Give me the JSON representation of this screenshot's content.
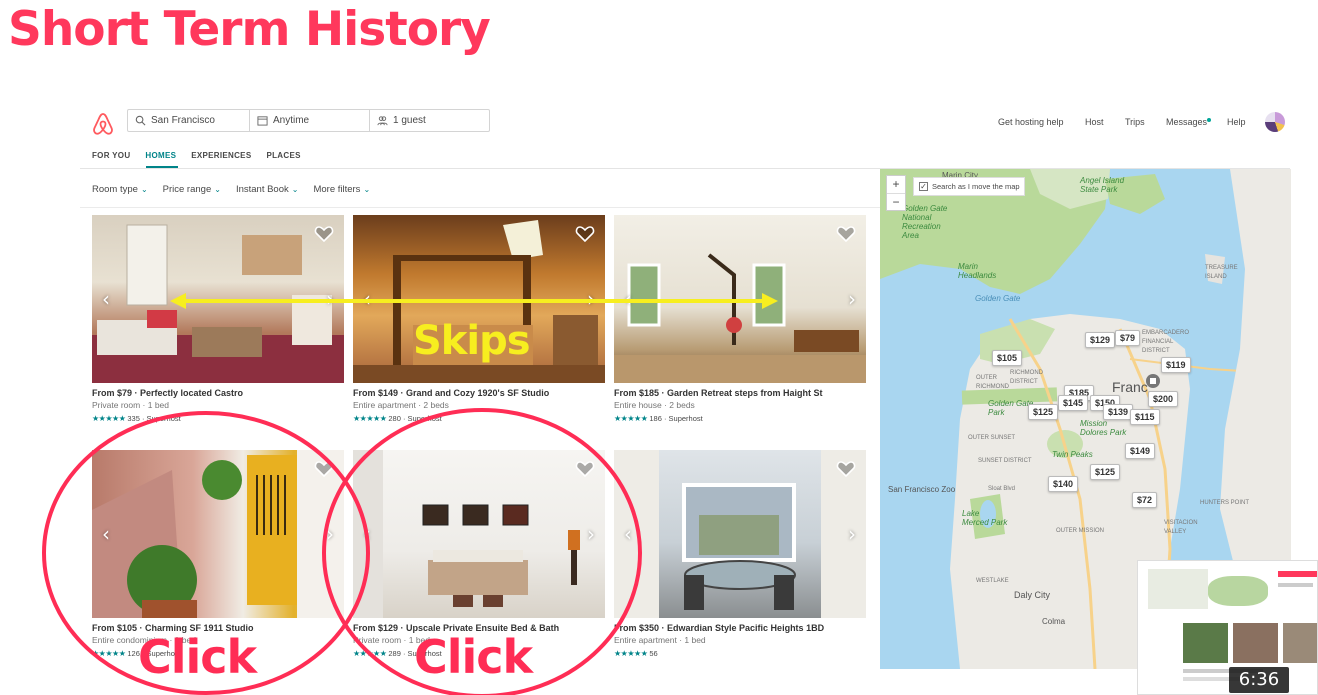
{
  "slide": {
    "title": "Short Term History"
  },
  "search": {
    "location": "San Francisco",
    "dates": "Anytime",
    "guests": "1 guest"
  },
  "topnav": {
    "hosting_help": "Get hosting help",
    "host": "Host",
    "trips": "Trips",
    "messages": "Messages",
    "help": "Help"
  },
  "tabs": [
    {
      "label": "FOR YOU"
    },
    {
      "label": "HOMES",
      "active": true
    },
    {
      "label": "EXPERIENCES"
    },
    {
      "label": "PLACES"
    }
  ],
  "filters": [
    {
      "label": "Room type"
    },
    {
      "label": "Price range"
    },
    {
      "label": "Instant Book"
    },
    {
      "label": "More filters"
    }
  ],
  "listings": [
    {
      "title": "From $79 · Perfectly located Castro",
      "sub": "Private room · 1 bed",
      "reviews": "335 · Superhost"
    },
    {
      "title": "From $149 · Grand and Cozy 1920's SF Studio",
      "sub": "Entire apartment · 2 beds",
      "reviews": "280 · Superhost"
    },
    {
      "title": "From $185 · Garden Retreat steps from Haight St",
      "sub": "Entire house · 2 beds",
      "reviews": "186 · Superhost"
    },
    {
      "title": "From $105 · Charming SF 1911 Studio",
      "sub": "Entire condominium · 1 bed",
      "reviews": "126 · Superhost"
    },
    {
      "title": "From $129 · Upscale Private Ensuite Bed & Bath",
      "sub": "Private room · 1 bed",
      "reviews": "289 · Superhost"
    },
    {
      "title": "From $350 · Edwardian Style Pacific Heights 1BD",
      "sub": "Entire apartment · 1 bed",
      "reviews": "56"
    }
  ],
  "rating_stars": "★★★★★",
  "map": {
    "search_toggle": "Search as I move the map",
    "zoom_in": "+",
    "zoom_out": "−",
    "pins": [
      "$129",
      "$79",
      "$105",
      "$119",
      "$185",
      "$145",
      "$150",
      "$200",
      "$125",
      "$139",
      "$115",
      "$149",
      "$125",
      "$140",
      "$72"
    ],
    "labels": {
      "angel_island": "Angel Island\nState Park",
      "golden_gate_rec": "Golden Gate\nNational\nRecreation\nArea",
      "marin_headlands": "Marin\nHeadlands",
      "treasure_island": "TREASURE\nISLAND",
      "golden_gate_park": "Golden Gate\nPark",
      "mission_dolores": "Mission\nDolores Park",
      "twin_peaks": "Twin Peaks",
      "sf_zoo": "San Francisco Zoo",
      "lake_merced": "Lake\nMerced Park",
      "daly_city": "Daly City",
      "colma": "Colma",
      "golden_gate": "Golden Gate",
      "marin_city": "Marin City",
      "san_francisco": "Franc",
      "richmond": "RICHMOND\nDISTRICT",
      "outer_richmond": "OUTER\nRICHMOND",
      "sunset": "SUNSET DISTRICT",
      "outer_sunset": "OUTER SUNSET",
      "outer_mission": "OUTER MISSION",
      "hunters_point": "HUNTERS POINT",
      "visitacion": "VISITACION\nVALLEY",
      "westlake": "WESTLAKE",
      "embarcadero": "EMBARCADERO\nFINANCIAL\nDISTRICT",
      "sloat": "Sloat Blvd"
    }
  },
  "annotations": {
    "skips": "Skips",
    "click_1": "Click",
    "click_2": "Click"
  },
  "video": {
    "timestamp": "6:36"
  },
  "colors": {
    "brand": "#ff385c",
    "teal": "#008489",
    "annotation_red": "#ff2d55",
    "annotation_yellow": "#f7ee1f"
  }
}
